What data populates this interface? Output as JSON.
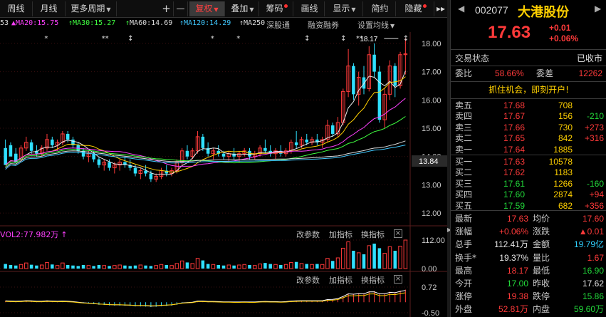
{
  "toolbar": {
    "items": [
      "周线",
      "月线",
      "更多周期",
      "+",
      "—",
      "复权",
      "叠加",
      "筹码",
      "画线",
      "显示",
      "简约",
      "隐藏"
    ],
    "arrows": "▸▸"
  },
  "legend": {
    "items": [
      {
        "text": "53",
        "color": "#dddddd"
      },
      {
        "text": "MA20:15.75",
        "color": "#ff40ff"
      },
      {
        "text": "MA30:15.27",
        "color": "#40ff40"
      },
      {
        "text": "MA60:14.69",
        "color": "#dddddd"
      },
      {
        "text": "MA120:14.29",
        "color": "#40c8ff"
      },
      {
        "text": "MA250",
        "color": "#dddddd"
      }
    ],
    "extras": [
      "深股通",
      "融资融券",
      "设置均线"
    ]
  },
  "indicator_panels": [
    {
      "label": "VOL2:77.982万",
      "buttons": [
        "改参数",
        "加指标",
        "换指标"
      ]
    },
    {
      "label": "",
      "buttons": [
        "改参数",
        "加指标",
        "换指标"
      ]
    }
  ],
  "chart_data": {
    "type": "candlestick",
    "price_axis": {
      "ticks": [
        "18.00",
        "17.00",
        "16.00",
        "15.00",
        "14.00",
        "13.00",
        "12.00"
      ],
      "ylim": [
        11.6,
        18.4
      ],
      "marker": "13.84"
    },
    "high_annotation": "18.17",
    "volume_axis": {
      "ticks": [
        "112.00",
        "0.00"
      ]
    },
    "macd_axis": {
      "ticks": [
        "0.72",
        "-0.50"
      ]
    },
    "series": [
      {
        "name": "MA20",
        "color": "#ff40ff"
      },
      {
        "name": "MA30",
        "color": "#40ff40"
      },
      {
        "name": "MA60",
        "color": "#dddddd"
      },
      {
        "name": "MA120",
        "color": "#40c8ff"
      }
    ],
    "candles": [
      [
        14.3,
        14.6,
        14.1,
        13.7
      ],
      [
        14.4,
        14.5,
        14.2,
        14.0
      ],
      [
        14.1,
        14.3,
        13.9,
        13.8
      ],
      [
        13.9,
        14.4,
        13.8,
        14.3
      ],
      [
        14.3,
        14.7,
        14.2,
        14.5
      ],
      [
        14.5,
        14.6,
        14.1,
        14.2
      ],
      [
        14.2,
        14.4,
        14.0,
        14.1
      ],
      [
        14.1,
        14.4,
        14.0,
        14.3
      ],
      [
        14.3,
        14.8,
        14.2,
        14.6
      ],
      [
        14.6,
        14.7,
        14.3,
        14.4
      ],
      [
        14.4,
        14.6,
        14.2,
        14.5
      ],
      [
        14.5,
        14.9,
        14.4,
        14.8
      ],
      [
        14.8,
        14.9,
        14.5,
        14.6
      ],
      [
        14.6,
        14.7,
        14.3,
        14.4
      ],
      [
        14.4,
        14.5,
        14.1,
        14.2
      ],
      [
        14.2,
        14.3,
        13.9,
        14.0
      ],
      [
        14.0,
        14.2,
        13.8,
        14.1
      ],
      [
        14.1,
        14.2,
        13.8,
        13.9
      ],
      [
        13.9,
        14.0,
        13.6,
        13.7
      ],
      [
        13.7,
        13.9,
        13.5,
        13.8
      ],
      [
        13.8,
        13.9,
        13.5,
        13.6
      ],
      [
        13.6,
        13.8,
        13.4,
        13.7
      ],
      [
        13.7,
        13.9,
        13.5,
        13.8
      ],
      [
        13.8,
        14.0,
        13.6,
        13.7
      ],
      [
        13.7,
        13.9,
        13.5,
        13.6
      ],
      [
        13.6,
        13.7,
        13.3,
        13.4
      ],
      [
        13.4,
        13.6,
        13.2,
        13.5
      ],
      [
        13.5,
        13.7,
        13.3,
        13.4
      ],
      [
        13.4,
        13.5,
        13.1,
        13.2
      ],
      [
        13.2,
        13.4,
        13.1,
        13.3
      ],
      [
        13.3,
        13.6,
        13.2,
        13.5
      ],
      [
        13.5,
        13.7,
        13.3,
        13.4
      ],
      [
        13.4,
        13.6,
        13.3,
        13.5
      ],
      [
        13.5,
        13.9,
        13.4,
        13.8
      ],
      [
        13.8,
        14.3,
        13.7,
        14.2
      ],
      [
        14.2,
        14.4,
        13.9,
        14.0
      ],
      [
        14.0,
        14.3,
        13.9,
        14.2
      ],
      [
        14.2,
        14.9,
        14.1,
        14.7
      ],
      [
        14.7,
        14.8,
        14.2,
        14.3
      ],
      [
        14.3,
        14.5,
        14.0,
        14.1
      ],
      [
        14.1,
        14.3,
        13.9,
        14.2
      ],
      [
        14.2,
        14.4,
        14.0,
        14.1
      ],
      [
        14.1,
        14.2,
        13.9,
        14.0
      ],
      [
        14.0,
        14.2,
        13.8,
        14.1
      ],
      [
        14.1,
        14.3,
        13.9,
        14.0
      ],
      [
        14.0,
        14.2,
        13.8,
        14.1
      ],
      [
        14.1,
        14.3,
        14.0,
        14.2
      ],
      [
        14.2,
        14.3,
        13.9,
        14.0
      ],
      [
        14.0,
        14.2,
        13.9,
        14.1
      ],
      [
        14.1,
        14.4,
        14.0,
        14.3
      ],
      [
        14.3,
        14.6,
        14.1,
        14.2
      ],
      [
        14.2,
        14.4,
        14.0,
        14.1
      ],
      [
        14.1,
        14.3,
        13.9,
        14.2
      ],
      [
        14.2,
        14.4,
        14.0,
        14.1
      ],
      [
        14.1,
        14.3,
        14.0,
        14.2
      ],
      [
        14.2,
        14.6,
        14.1,
        14.5
      ],
      [
        14.5,
        14.9,
        14.3,
        14.4
      ],
      [
        14.4,
        14.7,
        14.3,
        14.6
      ],
      [
        14.6,
        14.8,
        14.4,
        14.5
      ],
      [
        14.5,
        14.7,
        14.4,
        14.6
      ],
      [
        14.6,
        14.8,
        14.4,
        14.5
      ],
      [
        14.5,
        14.7,
        14.3,
        14.6
      ],
      [
        14.6,
        15.3,
        14.5,
        15.1
      ],
      [
        15.1,
        15.2,
        14.7,
        14.8
      ],
      [
        14.8,
        15.4,
        14.7,
        15.2
      ],
      [
        15.2,
        16.4,
        15.1,
        16.3
      ],
      [
        16.3,
        17.8,
        16.1,
        17.2
      ],
      [
        17.2,
        17.3,
        16.0,
        16.2
      ],
      [
        16.2,
        17.0,
        15.8,
        16.8
      ],
      [
        16.8,
        17.2,
        16.2,
        16.4
      ],
      [
        16.4,
        17.9,
        16.3,
        17.6
      ],
      [
        17.6,
        18.0,
        16.8,
        17.0
      ],
      [
        17.0,
        17.2,
        15.2,
        15.3
      ],
      [
        15.3,
        16.4,
        15.0,
        16.2
      ],
      [
        16.2,
        17.4,
        16.0,
        17.2
      ],
      [
        17.2,
        17.3,
        16.1,
        16.5
      ],
      [
        16.5,
        17.7,
        16.4,
        17.6
      ],
      [
        17.6,
        18.17,
        16.9,
        17.63
      ]
    ],
    "volumes": [
      18,
      14,
      12,
      16,
      22,
      15,
      12,
      14,
      24,
      16,
      12,
      22,
      14,
      12,
      10,
      14,
      12,
      10,
      14,
      12,
      10,
      12,
      14,
      12,
      10,
      12,
      14,
      12,
      10,
      12,
      16,
      14,
      12,
      20,
      30,
      24,
      20,
      40,
      32,
      18,
      16,
      14,
      12,
      14,
      12,
      14,
      16,
      14,
      12,
      18,
      22,
      18,
      16,
      14,
      16,
      24,
      26,
      20,
      18,
      16,
      18,
      16,
      40,
      30,
      42,
      80,
      105,
      70,
      62,
      56,
      90,
      98,
      80,
      60,
      86,
      70,
      88,
      112
    ],
    "macd": [
      0.05,
      0.04,
      0.03,
      0.04,
      0.06,
      0.05,
      0.03,
      0.03,
      0.05,
      0.04,
      0.03,
      0.04,
      0.03,
      0.01,
      -0.02,
      -0.05,
      -0.07,
      -0.09,
      -0.12,
      -0.13,
      -0.15,
      -0.16,
      -0.16,
      -0.17,
      -0.18,
      -0.2,
      -0.2,
      -0.21,
      -0.23,
      -0.22,
      -0.19,
      -0.18,
      -0.16,
      -0.12,
      -0.06,
      -0.04,
      -0.02,
      0.04,
      0.04,
      0.02,
      0.02,
      0.01,
      0.0,
      0.0,
      -0.01,
      -0.01,
      0.0,
      -0.01,
      -0.01,
      0.01,
      0.02,
      0.01,
      0.01,
      0.0,
      0.01,
      0.04,
      0.05,
      0.06,
      0.06,
      0.06,
      0.06,
      0.06,
      0.12,
      0.13,
      0.17,
      0.28,
      0.42,
      0.4,
      0.43,
      0.42,
      0.52,
      0.53,
      0.42,
      0.42,
      0.5,
      0.48,
      0.55,
      0.6
    ]
  },
  "quote": {
    "code": "002077",
    "name": "大港股份",
    "price": "17.63",
    "change": "+0.01",
    "change_pct": "+0.06%",
    "status_label": "交易状态",
    "status_value": "已收市",
    "weibi_label": "委比",
    "weibi_value": "58.66%",
    "weicha_label": "委差",
    "weicha_value": "12262",
    "promo": "抓住机会，即刻开户!",
    "asks": [
      {
        "label": "卖五",
        "price": "17.68",
        "vol": "708",
        "chg": ""
      },
      {
        "label": "卖四",
        "price": "17.67",
        "vol": "156",
        "chg": "-210"
      },
      {
        "label": "卖三",
        "price": "17.66",
        "vol": "730",
        "chg": "+273"
      },
      {
        "label": "卖二",
        "price": "17.65",
        "vol": "842",
        "chg": "+316"
      },
      {
        "label": "卖一",
        "price": "17.64",
        "vol": "1885",
        "chg": ""
      }
    ],
    "bids": [
      {
        "label": "买一",
        "price": "17.63",
        "vol": "10578",
        "chg": ""
      },
      {
        "label": "买二",
        "price": "17.62",
        "vol": "1183",
        "chg": ""
      },
      {
        "label": "买三",
        "price": "17.61",
        "vol": "1266",
        "chg": "-160"
      },
      {
        "label": "买四",
        "price": "17.60",
        "vol": "2874",
        "chg": "+94"
      },
      {
        "label": "买五",
        "price": "17.59",
        "vol": "682",
        "chg": "+356"
      }
    ],
    "stats": [
      {
        "l1": "最新",
        "v1": "17.63",
        "c1": "red",
        "l2": "均价",
        "v2": "17.60",
        "c2": "red"
      },
      {
        "l1": "涨幅",
        "v1": "+0.06%",
        "c1": "red",
        "l2": "涨跌",
        "v2": "▲0.01",
        "c2": "red"
      },
      {
        "l1": "总手",
        "v1": "112.41万",
        "c1": "white",
        "l2": "金额",
        "v2": "19.79亿",
        "c2": "cyan"
      },
      {
        "l1": "换手*",
        "v1": "19.37%",
        "c1": "white",
        "l2": "量比",
        "v2": "1.67",
        "c2": "red"
      },
      {
        "l1": "最高",
        "v1": "18.17",
        "c1": "red",
        "l2": "最低",
        "v2": "16.90",
        "c2": "green"
      },
      {
        "l1": "今开",
        "v1": "17.00",
        "c1": "green",
        "l2": "昨收",
        "v2": "17.62",
        "c2": "white"
      },
      {
        "l1": "涨停",
        "v1": "19.38",
        "c1": "red",
        "l2": "跌停",
        "v2": "15.86",
        "c2": "green"
      },
      {
        "l1": "外盘",
        "v1": "52.81万",
        "c1": "red",
        "l2": "内盘",
        "v2": "59.60万",
        "c2": "green"
      }
    ]
  }
}
